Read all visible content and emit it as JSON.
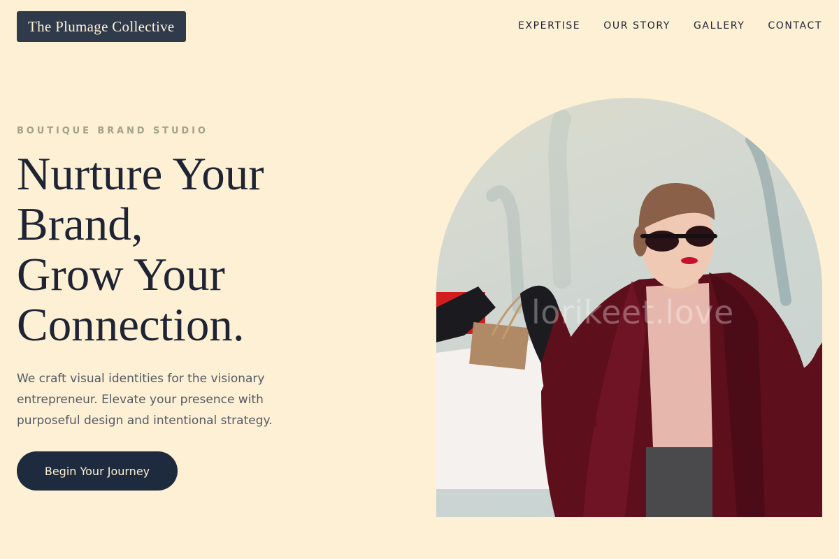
{
  "header": {
    "logo": "The Plumage Collective",
    "nav": [
      "EXPERTISE",
      "OUR STORY",
      "GALLERY",
      "CONTACT"
    ]
  },
  "hero": {
    "eyebrow": "BOUTIQUE BRAND STUDIO",
    "headline": [
      "Nurture Your",
      "Brand,",
      "Grow Your",
      "Connection."
    ],
    "description": "We craft visual identities for the visionary entrepreneur. Elevate your presence with purposeful design and intentional strategy.",
    "cta_label": "Begin Your Journey",
    "image_watermark": "lorikeet.love"
  },
  "colors": {
    "background": "#fdf0d5",
    "logo_bg": "#2f3a4b",
    "primary_text": "#1e2433",
    "eyebrow": "#a3a38a",
    "button_bg": "#1e2a3d"
  }
}
